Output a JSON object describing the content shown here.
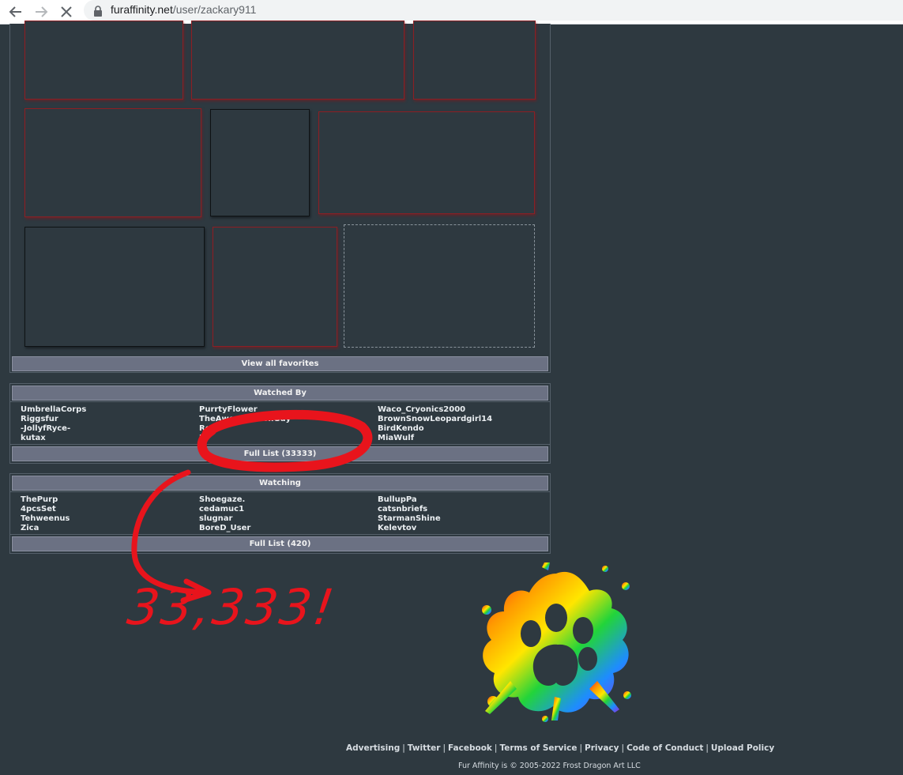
{
  "browser": {
    "url_host": "furaffinity.net",
    "url_path": "/user/zackary911",
    "back_icon": "arrow-left-icon",
    "forward_icon": "arrow-right-icon",
    "stop_icon": "close-icon",
    "lock_icon": "lock-icon"
  },
  "favorites": {
    "view_all_label": "View all favorites"
  },
  "watched_by": {
    "title": "Watched By",
    "columns": [
      [
        "UmbrellaCorps",
        "Riggsfur",
        "-JollyfRyce-",
        "kutax"
      ],
      [
        "PurrtyFlower",
        "TheAwesomeFoxGuy",
        "Rex",
        "B"
      ],
      [
        "Waco_Cryonics2000",
        "BrownSnowLeopardgirl14",
        "BirdKendo",
        "MiaWulf"
      ]
    ],
    "full_list_label": "Full List (33333)"
  },
  "watching": {
    "title": "Watching",
    "columns": [
      [
        "ThePurp",
        "4pcsSet",
        "Tehweenus",
        "Zica"
      ],
      [
        "Shoegaze.",
        "cedamuc1",
        "slugnar",
        "BoreD_User"
      ],
      [
        "BullupPa",
        "catsnbriefs",
        "StarmanShine",
        "Kelevtov"
      ]
    ],
    "full_list_label": "Full List (420)"
  },
  "annotation": {
    "text": "33,333!",
    "color": "#e8141c"
  },
  "footer": {
    "links": [
      "Advertising",
      "Twitter",
      "Facebook",
      "Terms of Service",
      "Privacy",
      "Code of Conduct",
      "Upload Policy"
    ],
    "copyright": "Fur Affinity is © 2005-2022 Frost Dragon Art LLC"
  },
  "colors": {
    "page_bg": "#2e3940",
    "bar_bg": "#6b7183",
    "thumb_red_border": "#8c1f24"
  }
}
